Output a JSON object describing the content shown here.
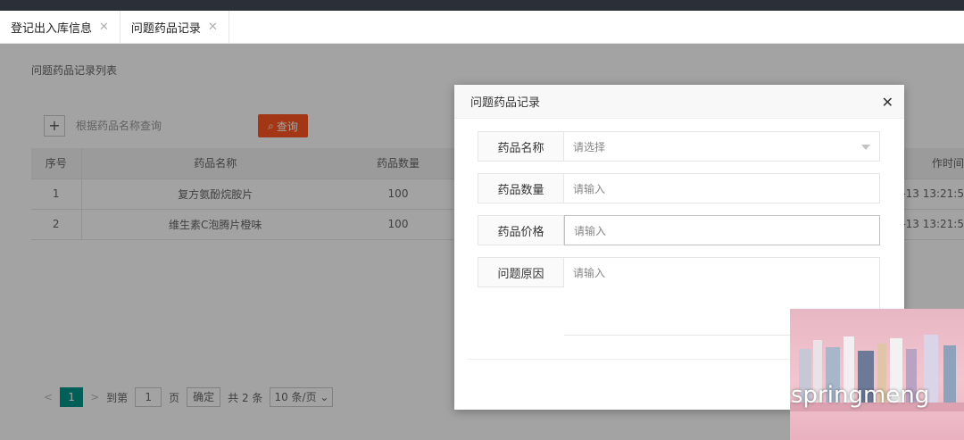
{
  "tabs": [
    {
      "label": "登记出入库信息"
    },
    {
      "label": "问题药品记录"
    }
  ],
  "panel_title": "问题药品记录列表",
  "toolbar": {
    "add_label": "+",
    "search_placeholder": "根据药品名称查询",
    "query_label": "查询"
  },
  "table": {
    "headers": [
      "序号",
      "药品名称",
      "药品数量",
      "作时间"
    ],
    "rows": [
      [
        "1",
        "复方氨酚烷胺片",
        "100",
        "-13 13:21:5"
      ],
      [
        "2",
        "维生素C泡腾片橙味",
        "100",
        "-13 13:21:5"
      ]
    ]
  },
  "pager": {
    "prev": "<",
    "current": "1",
    "next": ">",
    "goto_label": "到第",
    "goto_value": "1",
    "page_unit": "页",
    "confirm": "确定",
    "total": "共 2 条",
    "page_size": "10 条/页"
  },
  "modal": {
    "title": "问题药品记录",
    "close": "✕",
    "fields": [
      {
        "label": "药品名称",
        "placeholder": "请选择"
      },
      {
        "label": "药品数量",
        "placeholder": "请输入"
      },
      {
        "label": "药品价格",
        "placeholder": "请输入"
      },
      {
        "label": "问题原因",
        "placeholder": "请输入"
      }
    ]
  },
  "watermark": {
    "text": "springmeng",
    "icon": "wechat-icon"
  },
  "colors": {
    "accent": "#009688",
    "danger": "#ff5722"
  }
}
